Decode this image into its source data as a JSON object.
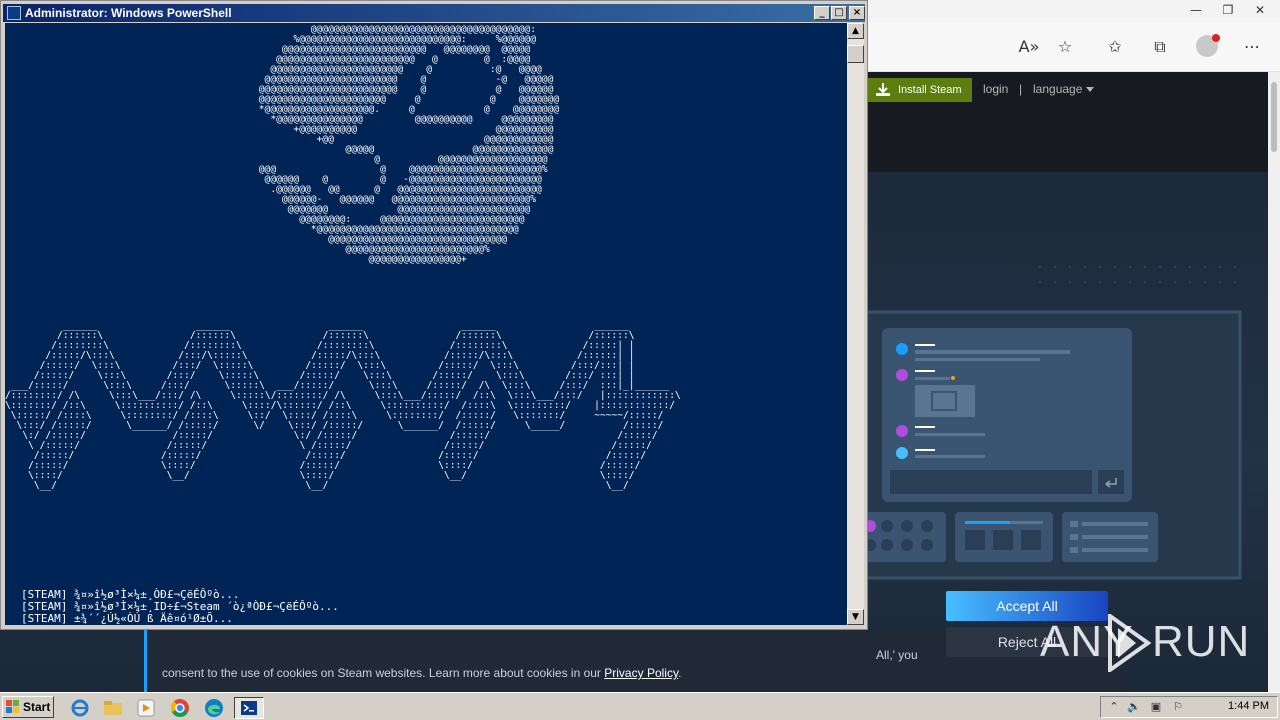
{
  "powershell": {
    "title": "Administrator: Windows PowerShell",
    "log": [
      "[STEAM] ¾¤»î½ø³Ì×¼±¸ÒÐ£¬ÇëÉÔºò...",
      "[STEAM] ¾¤»î½ø³Ì×¼±¸ID÷£¬Steam ´ò¿ªÒÐ£¬ÇëÉÔºò...",
      "[STEAM] ±¾´´¿Ú½«ÒÚ ß Äê¤ó¹Ø±Õ..."
    ],
    "ascii_top": "          @@@@@@@@@@@@@@@@@@@@@@@@@@@@@@@@@@@@@@:\n       %@@@@@@@@@@@@@@@@@@@@@@@@@@@@:     %@@@@@@\n     @@@@@@@@@@@@@@@@@@@@@@@@@   @@@@@@@@  @@@@@\n    @@@@@@@@@@@@@@@@@@@@@@@@   @        @  :@@@@\n   @@@@@@@@@@@@@@@@@@@@@@@    @          :@   @@@@\n  @@@@@@@@@@@@@@@@@@@@@@@    @            -@   @@@@@\n @@@@@@@@@@@@@@@@@@@@@@@@    @            @   @@@@@@\n @@@@@@@@@@@@@@@@@@@@@@     @            @    @@@@@@@\n *@@@@@@@@@@@@@@@@@@@.     @            @    @@@@@@@@\n   *@@@@@@@@@@@@@@@         @@@@@@@@@@     @@@@@@@@@\n       +@@@@@@@@@@                        @@@@@@@@@@\n           +@@                          @@@@@@@@@@@@\n                @@@@@                 @@@@@@@@@@@@@@\n                     @          @@@@@@@@@@@@@@@@@@@\n @@@                  @    @@@@@@@@@@@@@@@@@@@@@@@%\n  @@@@@@    @         @   -@@@@@@@@@@@@@@@@@@@@@@@\n   .@@@@@@   @@      @   @@@@@@@@@@@@@@@@@@@@@@@@@\n     @@@@@@-   @@@@@@   @@@@@@@@@@@@@@@@@@@@@@@@%\n      @@@@@@@            @@@@@@@@@@@@@@@@@@@@@@@\n        @@@@@@@@:     @@@@@@@@@@@@@@@@@@@@@@@@@\n          *@@@@@@@@@@@@@@@@@@@@@@@@@@@@@@@@@@@\n             @@@@@@@@@@@@@@@@@@@@@@@@@@@@@@@\n                @@@@@@@@@@@@@@@@@@@@@@@@%\n                    @@@@@@@@@@@@@@@@+",
    "ascii_bottom": "          ______                 ______                 ______                 ______                 ______\n         /::::::\\               /::::::\\               /::::::\\               /::::::\\               /::::::\\\n        /::::::::\\             /::::::::\\             /::::::::\\             /::::::::\\             /:::::| |\n       /:::::/\\:::\\           /:::/\\:::::\\           /:::::/\\:::\\           /:::::/\\:::\\           /::::::| |\n      /:::::/  \\:::\\         /:::/  \\:::::\\         /:::::/  \\:::\\         /:::::/  \\:::\\         /:::/:::| |\n     /:::::/    \\:::\\       /:::/    \\:::::\\       /:::::/    \\:::\\       /:::::/    \\:::\\       /:::/ :::| |\n ___/:::::/      \\:::\\     /:::/      \\:::::\\  ___/:::::/      \\:::\\     /:::::/  /\\  \\:::\\     /:::/  :::|_|______\n/::::::::/ /\\     \\:::\\___/:::/ /\\     \\:::::\\/::::::::/ /\\     \\:::\\___/:::::/  /::\\  \\:::\\___/:::/   |::::::::::::\\\n\\:::::::/ /::\\     \\::::::::::/ /::\\     \\::::/\\::::::/ /::\\     \\::::::::::/  /::::\\  \\:::::::::/    |::::::::::::/\n \\:::::/ /::::\\     \\::::::::/ /::::\\     \\::/  \\::::/ /::::\\     \\::::::::/  /:::::/   \\:::::::/     ~~~~~/:::::/\n  \\:::/ /:::::/      \\______/ /:::::/      \\/    \\:::/ /:::::/      \\______/  /:::::/     \\_____/          /:::::/\n   \\:/ /:::::/               /:::::/              \\:/ /:::::/                /:::::/                      /:::::/\n    \\ /:::::/               /:::::/                \\ /:::::/                /:::::/                      /:::::/\n     /:::::/               /:::::/                  /:::::/                /:::::/                      /:::::/\n    /:::::/                \\::::/                  /:::::/                 \\::::/                      /:::::/\n    \\::::/                  \\__/                   \\::::/                   \\__/                       \\::::/\n     \\__/                                           \\__/                                                \\__/"
  },
  "browser": {
    "header": {
      "install_label": "Install Steam",
      "login_label": "login",
      "separator": "|",
      "language_label": "language"
    },
    "cookie": {
      "line1_tail": "All,' you",
      "line2_text": "consent to the use of cookies on Steam websites. Learn more about cookies in our ",
      "privacy_link": "Privacy Policy",
      "line2_end": "."
    },
    "accept_label": "Accept All",
    "reject_label": "Reject All"
  },
  "watermark": {
    "any": "ANY",
    "run": "RUN"
  },
  "taskbar": {
    "start_label": "Start",
    "clock": "1:44 PM"
  }
}
